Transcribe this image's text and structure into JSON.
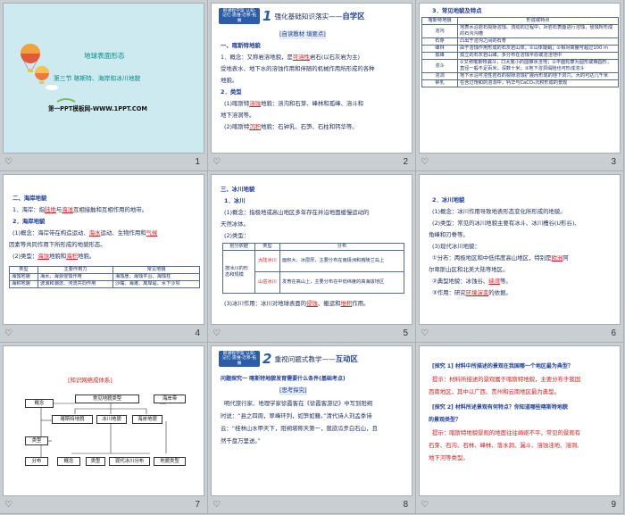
{
  "colors": {
    "accent": "#1f3e9a",
    "highlight": "#d52020",
    "background": "#c9ced3",
    "cover": "#cdeaf0"
  },
  "slide_numbers": [
    "1",
    "2",
    "3",
    "4",
    "5",
    "6",
    "7",
    "8",
    "9"
  ],
  "s1": {
    "title": "地球表面形态",
    "subtitle": "第三节  喀斯特、海岸和冰川地貌",
    "footer": "第一PPT模板网-WWW.1PPT.COM"
  },
  "s2": {
    "badge": "新课程学案 认知·记忆·思维·迁移·拓展",
    "banner_num": "1",
    "banner_text": "强化基础知识落实——",
    "banner_strong": "自学区",
    "tag": "[自读教材 填要点]",
    "h1": "一、喀斯特地貌",
    "l1a": "1．概念：又称岩溶地貌，是",
    "l1b": "可溶性",
    "l1c": "岩石(以石灰岩为主)",
    "l2": "受地表水、地下水的溶蚀作用和伴随的机械作用所形成的各种",
    "l3": "地貌。",
    "h2": "2．类型",
    "l4a": "(1)喀斯特",
    "l4b": "溶蚀",
    "l4c": "地貌：溶沟和石芽、峰林和孤峰、溶斗和",
    "l5": "地下溶洞等。",
    "l6a": "(2)喀斯特",
    "l6b": "沉积",
    "l6c": "地貌：石钟乳、石笋、石柱和钙华等。"
  },
  "s3": {
    "title": "3．常见地貌及特点",
    "head": [
      "喀斯特地貌",
      "形成或特点"
    ],
    "rows": [
      [
        "溶沟",
        "地表水沿岩石裂隙溶蚀、流动的过程中，对岩石表面进行溶蚀，侵蚀所形成的石沟沟槽"
      ],
      [
        "石芽",
        "凸出于溶沟之间的石脊"
      ],
      [
        "峰林",
        "由于溶蚀作用形成的石灰岩山体，①山体陡峭；②相对高度可超过100 m"
      ],
      [
        "孤峰",
        "孤立的石灰岩山峰，多分布在溶蚀平原或溶洼地中"
      ],
      [
        "溶斗",
        "①又称喀斯特漏斗，口大底小的圆锥状洼地；②平面轮廓为圆形或椭圆形，直径一般不足百米，深数十米；③地下溶洞塌陷也可形成溶斗"
      ],
      [
        "溶洞",
        "地下水沿可溶性岩石的裂隙溶蚀扩展而形成的地下洞穴，大的可达几千米"
      ],
      [
        "钟乳",
        "在含过饱和的溶洞中，钙华与CaCO₃沉积形成的景观"
      ]
    ]
  },
  "s4": {
    "h": "二、海岸地貌",
    "l1a": "1．海岸：指",
    "l1b": "陆地",
    "l1c": "与",
    "l1d": "海洋",
    "l1e": "互相接触和互相作用的地带。",
    "h2": "2．海岸地貌",
    "l2a": "(1)概念：海岸带在构造运动、",
    "l2b": "海水",
    "l2c": "运动、生物作用和",
    "l2d": "气候",
    "l3": "因素等共同作用下所形成的地貌形态。",
    "l4a": "(2)类型：",
    "l4b": "海蚀",
    "l4c": "地貌和",
    "l4d": "海积",
    "l4e": "地貌。",
    "head": [
      "类型",
      "主要作用力",
      "常见地貌"
    ],
    "rows": [
      [
        "海蚀地貌",
        "海水、海浪侵蚀作用",
        "海蚀崖、海蚀平台、海蚀柱"
      ],
      [
        "海积地貌",
        "波浪和潮流、河流共同作用",
        "沙嘴、海滩、离岸堤、水下沙坝"
      ]
    ]
  },
  "s5": {
    "h": "三、冰川地貌",
    "h1": "1．冰川",
    "l1a": "(1)概念：指极地或高山地区多年存在并沿地面缓慢运动的",
    "l1b": "天然冰体。",
    "l2": "(2)类型：",
    "head": [
      "划分依据",
      "类型",
      "分布"
    ],
    "crit": "按冰川的形态和规模",
    "rows": [
      [
        "大陆冰川",
        "面积大、冰层厚，主要分布在南极洲和格陵兰岛上"
      ],
      [
        "山岳冰川",
        "发育在高山上，主要分布在中低纬度的高海拔地区"
      ]
    ],
    "l3a": "(3)冰川作用：冰川对地球表面的",
    "l3b": "侵蚀",
    "l3c": "、搬运和",
    "l3d": "堆积",
    "l3e": "作用。"
  },
  "s6": {
    "h": "2．冰川地貌",
    "l1": "(1)概念：冰川作用导致地表形态变化所形成的地貌。",
    "l2a": "(2)类型：常见的冰川地貌主要有冰斗、冰川槽谷(U形谷)、",
    "l2b": "角峰和刃脊等。",
    "l3": "(3)现代冰川地貌：",
    "l4a": "①分布：两极地区和中低纬度高山地区，特别是",
    "l4b": "欧洲",
    "l4c": "阿",
    "l4d": "尔卑斯山区和北美大陆等地区。",
    "l5a": "②典型地貌：冰蚀谷、",
    "l5b": "峡湾",
    "l5c": "等。",
    "l6a": "③作用：研究",
    "l6b": "环境演变",
    "l6c": "的依据。"
  },
  "s7": {
    "title": "[知识网络成体系]",
    "boxes": [
      "概念",
      "常见地貌类型",
      "海岸带",
      "类型",
      "喀斯特地貌",
      "冰川地貌",
      "海岸地貌",
      "分布",
      "概念",
      "类型",
      "现代冰川分布",
      "地貌类型"
    ]
  },
  "s8": {
    "badge": "新课程学案 认知·记忆·思维·迁移·拓展",
    "banner_num": "2",
    "banner_text": "重视问题式教学——",
    "banner_strong": "互动区",
    "q": "问题探究一  喀斯特地貌发育需要什么条件(基础考点)",
    "tag": "[思考探究]",
    "p1": "明代旅行家、地理学家徐霞客在《徐霞客游记》中写到阳朔",
    "p2": "时说：“县之四周，翠峰环列，如笋如簪。”清代诗人刘孟季诗",
    "p3": "云：“桂林山水甲天下，阳朔堪称天第一，我欲瓜步白石山，且",
    "p4": "然千盘万里送。”"
  },
  "s9": {
    "q1": "[探究 1]   材料中所描述的景观在我国哪一个地区最为典型？",
    "a1lab": "提示：",
    "a1": "材料所描述的景观属于喀斯特地貌，主要分布于我国",
    "a1b": "西南地区，其中以广西、贵州和云南地区最为典型。",
    "q2": "[探究 2]   材料所述景观有何特点？你知道哪些喀斯特地貌",
    "q2b": "的景观类型？",
    "a2lab": "提示：",
    "a2": "喀斯特地貌景观的地面往往崎岖不平，常见的景观有",
    "a2b": "石芽、石沟、石林、峰林、落水洞、漏斗、溶蚀洼地、溶洞、",
    "a2c": "地下河等类型。"
  }
}
